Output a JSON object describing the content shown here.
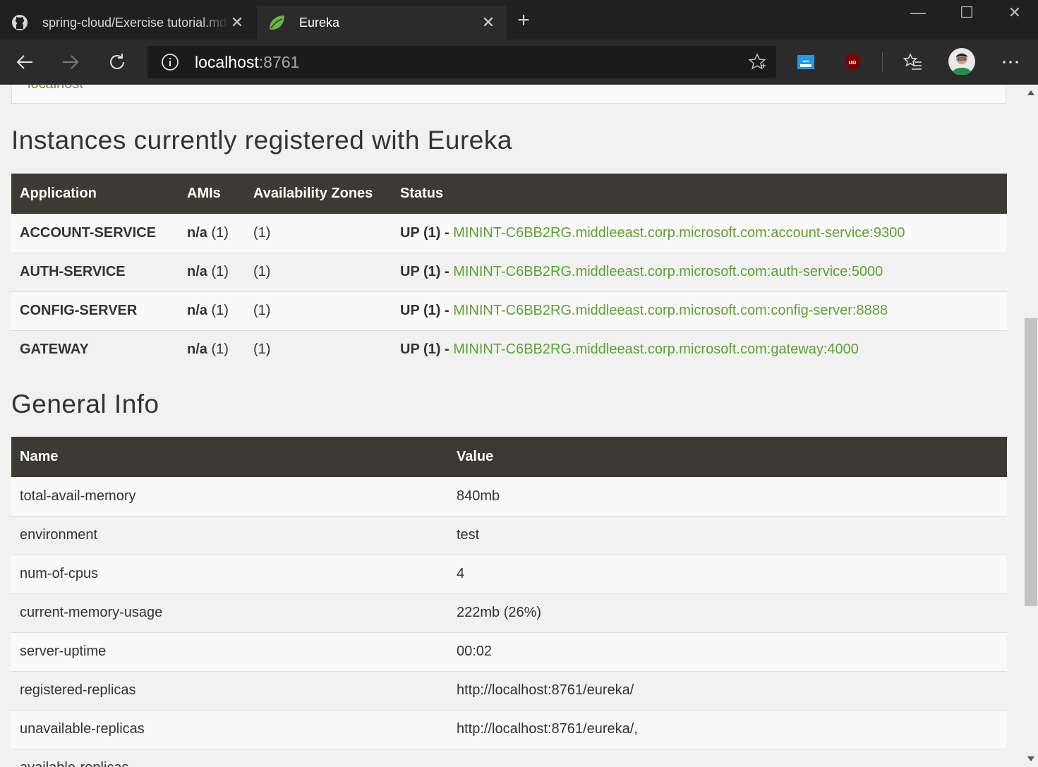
{
  "browser": {
    "tabs": [
      {
        "title": "spring-cloud/Exercise tutorial.md",
        "icon": "github-icon",
        "active": false
      },
      {
        "title": "Eureka",
        "icon": "spring-leaf-icon",
        "active": true
      }
    ],
    "address": {
      "host": "localhost",
      "port": ":8761"
    },
    "colors": {
      "chrome_dark": "#202020",
      "toolbar": "#2b2b2b",
      "brand_green": "#6db33f"
    }
  },
  "page": {
    "top_box_text": "localhost",
    "instances_heading": "Instances currently registered with Eureka",
    "instances_table": {
      "headers": [
        "Application",
        "AMIs",
        "Availability Zones",
        "Status"
      ],
      "rows": [
        {
          "application": "ACCOUNT-SERVICE",
          "amis": "n/a",
          "amis_count": "(1)",
          "zones": "(1)",
          "status": "UP (1) - ",
          "link": "MININT-C6BB2RG.middleeast.corp.microsoft.com:account-service:9300"
        },
        {
          "application": "AUTH-SERVICE",
          "amis": "n/a",
          "amis_count": "(1)",
          "zones": "(1)",
          "status": "UP (1) - ",
          "link": "MININT-C6BB2RG.middleeast.corp.microsoft.com:auth-service:5000"
        },
        {
          "application": "CONFIG-SERVER",
          "amis": "n/a",
          "amis_count": "(1)",
          "zones": "(1)",
          "status": "UP (1) - ",
          "link": "MININT-C6BB2RG.middleeast.corp.microsoft.com:config-server:8888"
        },
        {
          "application": "GATEWAY",
          "amis": "n/a",
          "amis_count": "(1)",
          "zones": "(1)",
          "status": "UP (1) - ",
          "link": "MININT-C6BB2RG.middleeast.corp.microsoft.com:gateway:4000"
        }
      ]
    },
    "general_heading": "General Info",
    "general_table": {
      "headers": [
        "Name",
        "Value"
      ],
      "rows": [
        {
          "name": "total-avail-memory",
          "value": "840mb"
        },
        {
          "name": "environment",
          "value": "test"
        },
        {
          "name": "num-of-cpus",
          "value": "4"
        },
        {
          "name": "current-memory-usage",
          "value": "222mb (26%)"
        },
        {
          "name": "server-uptime",
          "value": "00:02"
        },
        {
          "name": "registered-replicas",
          "value": "http://localhost:8761/eureka/"
        },
        {
          "name": "unavailable-replicas",
          "value": "http://localhost:8761/eureka/,"
        },
        {
          "name": "available-replicas",
          "value": ""
        }
      ]
    },
    "link_color": "#5fa134",
    "header_bg": "#3d3933"
  }
}
